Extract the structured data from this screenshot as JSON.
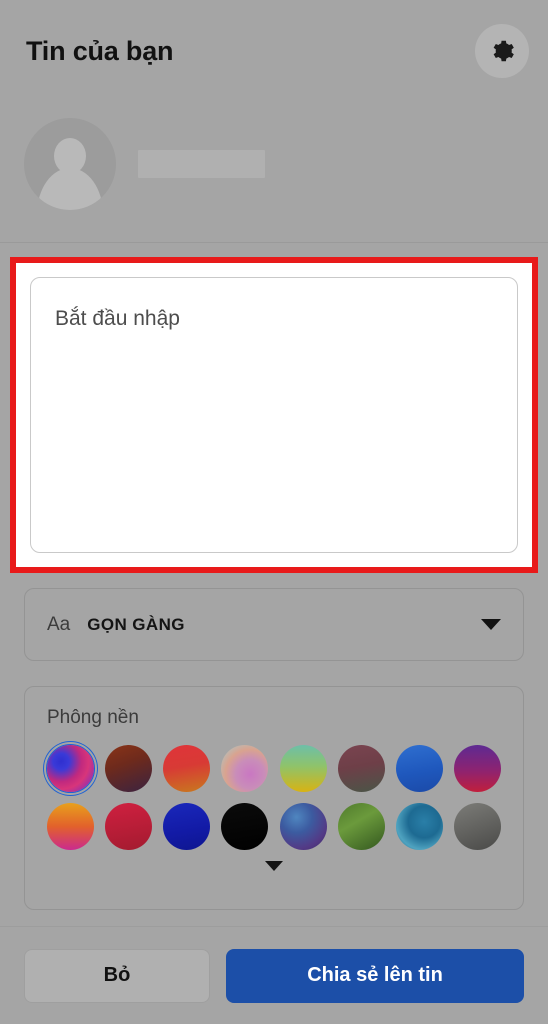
{
  "header": {
    "title": "Tin của bạn",
    "settings_icon": "gear-icon",
    "avatar_icon": "person-avatar-icon",
    "user_name": ""
  },
  "compose": {
    "placeholder": "Bắt đầu nhập",
    "value": "",
    "highlight_color": "#e81a1a"
  },
  "font_selector": {
    "icon_label": "Aa",
    "selected_font": "GỌN GÀNG",
    "chevron_icon": "chevron-down-icon"
  },
  "background": {
    "title": "Phông nền",
    "expand_icon": "chevron-down-icon",
    "selected_index": 0,
    "swatches": [
      {
        "name": "blue-magenta-swirl",
        "css": "radial-gradient(circle at 30% 35%, #2f2fd0 0%, #3a3ad8 18%, #c0297f 45%, #d8357a 62%, #8d2fb5 85%, #3a3ad8 100%)"
      },
      {
        "name": "dark-maroon",
        "css": "linear-gradient(160deg, #8a3418 0%, #6e2a1c 40%, #3b2340 100%)"
      },
      {
        "name": "red-orange",
        "css": "linear-gradient(170deg, #e0343a 0%, #d83a35 45%, #c87a1e 100%)"
      },
      {
        "name": "pastel-teal-pink",
        "css": "radial-gradient(circle at 62% 62%, #c977c2 0%, #c98db9 35%, #d9a38f 60%, #9fd0d4 100%)"
      },
      {
        "name": "teal-yellow",
        "css": "linear-gradient(180deg, #6dbfa8 0%, #8fc36a 45%, #d8b313 100%)"
      },
      {
        "name": "muted-maroon-green",
        "css": "linear-gradient(170deg, #7a4450 0%, #6e3f48 45%, #4a5547 100%)"
      },
      {
        "name": "royal-blue",
        "css": "linear-gradient(170deg, #2f6fd0 0%, #1f58bd 55%, #1b4aa8 100%)"
      },
      {
        "name": "purple-crimson",
        "css": "linear-gradient(180deg, #5e2a92 0%, #8e2370 55%, #c11f3c 100%)"
      }
    ],
    "swatches_row2": [
      {
        "name": "orange-magenta",
        "css": "linear-gradient(180deg, #e8a01c 0%, #e2612b 50%, #cb2a8e 100%)"
      },
      {
        "name": "crimson-red",
        "css": "linear-gradient(170deg, #cf2040 0%, #b51d36 60%, #a31b30 100%)"
      },
      {
        "name": "deep-blue",
        "css": "linear-gradient(170deg, #1a28bb 0%, #121aa5 60%, #0e1690 100%)"
      },
      {
        "name": "black",
        "css": "linear-gradient(170deg, #0b0b0b 0%, #000000 100%)"
      },
      {
        "name": "blue-purple-nebula",
        "css": "radial-gradient(circle at 35% 30%, #4f86c0 0%, #3c5ba0 35%, #533a86 70%, #3c2a64 100%)"
      },
      {
        "name": "green-foliage",
        "css": "linear-gradient(150deg, #4f7a2c 0%, #6b9a3c 40%, #33571f 100%)"
      },
      {
        "name": "teal-ocean",
        "css": "radial-gradient(circle at 60% 40%, #2a7fa8 0%, #1d6a92 40%, #4fa3c0 70%, #1b5a80 100%)"
      },
      {
        "name": "gray-stone",
        "css": "linear-gradient(160deg, #7c7c78 0%, #636360 50%, #4a4a48 100%)"
      }
    ]
  },
  "footer": {
    "discard_label": "Bỏ",
    "share_label": "Chia sẻ lên tin",
    "share_color": "#1c4fa8"
  }
}
